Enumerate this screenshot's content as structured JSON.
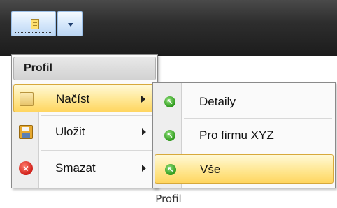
{
  "toolbar": {
    "main_button_icon": "document-icon",
    "split_button_icon": "chevron-down-icon"
  },
  "menu": {
    "header": "Profil",
    "items": [
      {
        "label": "Načíst",
        "icon": "folder-icon",
        "highlighted": true,
        "has_submenu": true
      },
      {
        "label": "Uložit",
        "icon": "floppy-disk-icon",
        "highlighted": false,
        "has_submenu": true
      },
      {
        "label": "Smazat",
        "icon": "delete-icon",
        "highlighted": false,
        "has_submenu": true
      }
    ]
  },
  "submenu": {
    "items": [
      {
        "label": "Detaily",
        "icon": "green-arrow-icon",
        "highlighted": false
      },
      {
        "label": "Pro firmu XYZ",
        "icon": "green-arrow-icon",
        "highlighted": false
      },
      {
        "label": "Vše",
        "icon": "green-arrow-icon",
        "highlighted": true
      }
    ]
  },
  "caption": "Profil",
  "colors": {
    "highlight": "#ffe792",
    "highlight_border": "#d7a93b",
    "toolbar_bg": "#2e2e2e",
    "button_blue": "#bcd7f4"
  }
}
